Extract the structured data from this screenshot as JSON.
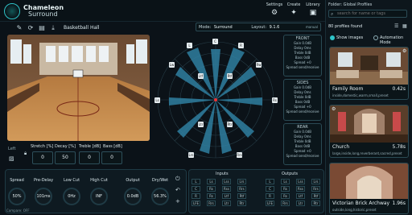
{
  "app": {
    "name_line1": "Chameleon",
    "name_line2": "Surround"
  },
  "topmenu": [
    {
      "label": "Settings",
      "icon": "gear-icon",
      "glyph": "⚙"
    },
    {
      "label": "Create",
      "icon": "magic-icon",
      "glyph": "✦"
    },
    {
      "label": "Library",
      "icon": "folder-icon",
      "glyph": "▣"
    }
  ],
  "toolbar": {
    "preset_name": "Basketball Hall"
  },
  "modebar": {
    "mode_label": "Mode:",
    "mode_value": "Surround",
    "layout_label": "Layout:",
    "layout_value": "9.1.6",
    "tag": "manual"
  },
  "sliders": [
    {
      "label": "Stretch [%]",
      "value": "0"
    },
    {
      "label": "Decay [%]",
      "value": "50"
    },
    {
      "label": "Treble [dB]",
      "value": "0"
    },
    {
      "label": "Bass [dB]",
      "value": "0"
    }
  ],
  "left_tools": {
    "tag": "Left"
  },
  "speakers": [
    "C",
    "L",
    "R",
    "Ls",
    "Rs",
    "Lrs",
    "Rrs",
    "Lw",
    "Rw",
    "Ltf",
    "Rtf",
    "Ltr",
    "Rtr"
  ],
  "side_panels": [
    {
      "title": "FRONT",
      "rows": [
        "Gain 0.0dB",
        "Delay 0ms",
        "Treble 0dB",
        "Bass 0dB",
        "Spread +0",
        "Spread send/receive"
      ]
    },
    {
      "title": "SIDES",
      "rows": [
        "Gain 0.0dB",
        "Delay 0ms",
        "Treble 0dB",
        "Bass 0dB",
        "Spread +0",
        "Spread send/receive"
      ]
    },
    {
      "title": "REAR",
      "rows": [
        "Gain 0.0dB",
        "Delay 0ms",
        "Treble 0dB",
        "Bass 0dB",
        "Spread +0",
        "Spread send/receive"
      ]
    }
  ],
  "knobs": [
    {
      "label": "Spread",
      "value": "50%"
    },
    {
      "label": "Pre-Delay",
      "value": "101ms"
    },
    {
      "label": "Low Cut",
      "value": "0Hz"
    },
    {
      "label": "High Cut",
      "value": "INF"
    },
    {
      "label": "Output",
      "value": "0.0dB"
    },
    {
      "label": "Dry/Wet",
      "value": "56.3%"
    }
  ],
  "compare": "Compare: OFF",
  "io": {
    "inputs_title": "Inputs",
    "outputs_title": "Outputs",
    "rows": [
      [
        "L",
        "Ls",
        "Lss",
        "Lrs"
      ],
      [
        "C",
        "Rs",
        "Rss",
        "Rrs"
      ],
      [
        "R",
        "Rs",
        "Ltf",
        "Rtf"
      ],
      [
        "LFE",
        "Rrs",
        "Ltr",
        "Rtr"
      ]
    ],
    "out_rows": [
      [
        "L",
        "Ls",
        "Lss",
        "Lrs"
      ],
      [
        "C",
        "Rs",
        "Rss",
        "Rrs"
      ],
      [
        "R",
        "Rs",
        "Ltf",
        "Rtf"
      ],
      [
        "LFE",
        "Rrs",
        "Ltr",
        "Rtr"
      ]
    ]
  },
  "library": {
    "folder": "Folder: Global Profiles",
    "search_placeholder": "search for name or tags",
    "count": "80 profiles found",
    "show_images": "Show images",
    "automation": "Automation Mode",
    "cards": [
      {
        "name": "Family Room",
        "duration": "0.42s",
        "tags": "inside,domestic,warm,small,preset"
      },
      {
        "name": "Church",
        "duration": "5.78s",
        "tags": "large,inside,long,reverberant,sacred,preset"
      },
      {
        "name": "Victorian Brick Archway",
        "duration": "1.96s",
        "tags": "outside,long,historic,preset"
      }
    ]
  },
  "colors": {
    "accent": "#2ec4c8",
    "bg": "#0b1218",
    "border": "#2a4a54"
  }
}
